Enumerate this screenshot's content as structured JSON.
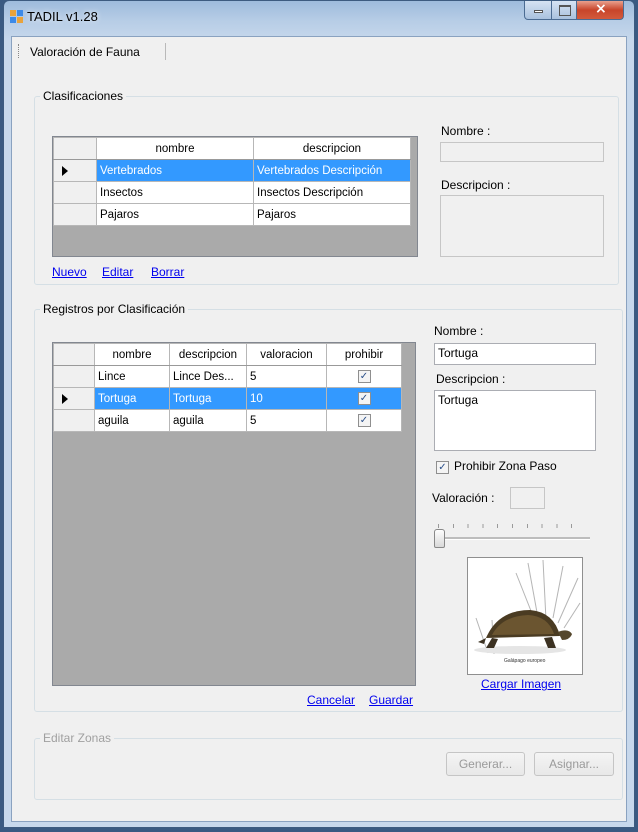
{
  "window": {
    "title": "TADIL v1.28"
  },
  "menu": {
    "items": [
      "Valoración de Fauna"
    ]
  },
  "clasificaciones": {
    "group_title": "Clasificaciones",
    "columns": [
      "nombre",
      "descripcion"
    ],
    "rows": [
      {
        "nombre": "Vertebrados",
        "descripcion": "Vertebrados Descripción"
      },
      {
        "nombre": "Insectos",
        "descripcion": "Insectos Descripción"
      },
      {
        "nombre": "Pajaros",
        "descripcion": "Pajaros"
      }
    ],
    "selected_row": 0,
    "links": {
      "nuevo": "Nuevo",
      "editar": "Editar",
      "borrar": "Borrar"
    },
    "nombre_label": "Nombre :",
    "nombre_value": "",
    "descripcion_label": "Descripcion :",
    "descripcion_value": ""
  },
  "registros": {
    "group_title": "Registros por Clasificación",
    "columns": [
      "nombre",
      "descripcion",
      "valoracion",
      "prohibir"
    ],
    "rows": [
      {
        "nombre": "Lince",
        "descripcion": "Lince Des...",
        "valoracion": "5",
        "prohibir": true
      },
      {
        "nombre": "Tortuga",
        "descripcion": "Tortuga",
        "valoracion": "10",
        "prohibir": true
      },
      {
        "nombre": "aguila",
        "descripcion": "aguila",
        "valoracion": "5",
        "prohibir": true
      }
    ],
    "selected_row": 1,
    "nombre_label": "Nombre :",
    "nombre_value": "Tortuga",
    "descripcion_label": "Descripcion :",
    "descripcion_value": "Tortuga",
    "prohibir_label": "Prohibir Zona Paso",
    "prohibir_checked": true,
    "valoracion_label": "Valoración :",
    "valoracion_value": "",
    "slider_value": 0,
    "image_caption": "Galápago europeo",
    "cargar_imagen": "Cargar Imagen",
    "cancelar": "Cancelar",
    "guardar": "Guardar"
  },
  "editar_zonas": {
    "group_title": "Editar Zonas",
    "generar": "Generar...",
    "asignar": "Asignar..."
  },
  "colors": {
    "selection": "#3399ff",
    "grid_background": "#aaaaaa",
    "link": "#0000ee"
  }
}
